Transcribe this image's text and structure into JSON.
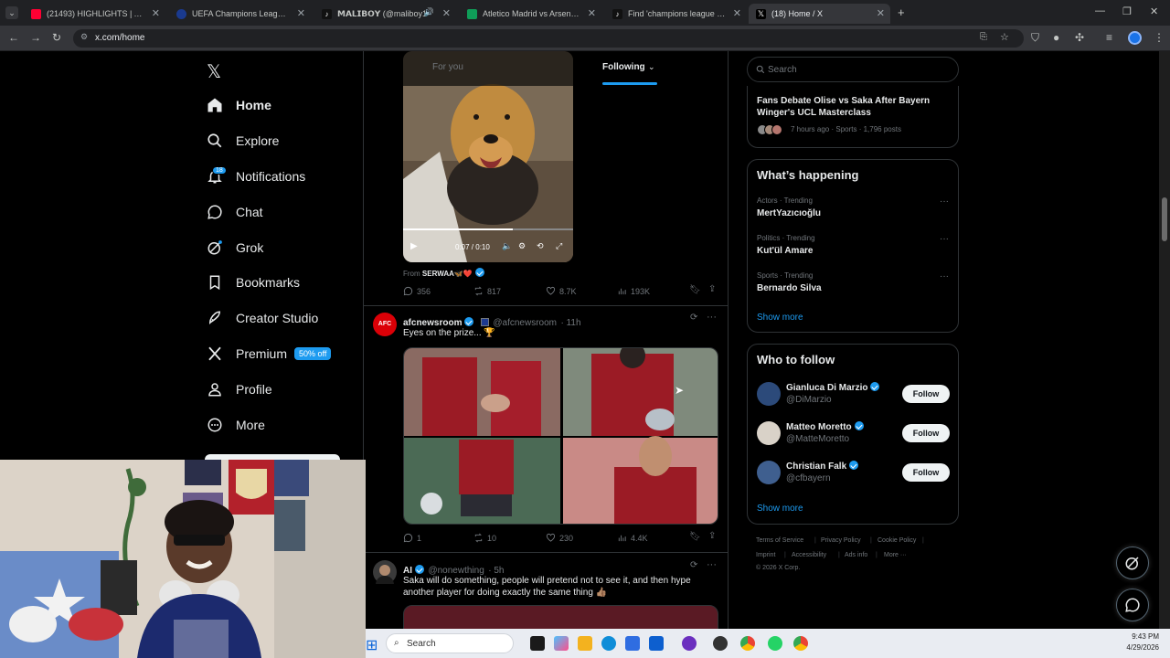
{
  "browser": {
    "tabs": [
      {
        "title": "(21493) HIGHLIGHTS | Arsenal v",
        "favicon_color": "#ff0033"
      },
      {
        "title": "UEFA Champions League | UEFA",
        "favicon_color": "#1a3a8f"
      },
      {
        "title": "𝗠𝗔𝗟𝗜𝗕𝗢𝗬 (@maliboy1",
        "favicon_color": "#111111"
      },
      {
        "title": "Atletico Madrid vs Arsenal - live",
        "favicon_color": "#0f9d58"
      },
      {
        "title": "Find 'champions league song' o",
        "favicon_color": "#111111"
      },
      {
        "title": "(18) Home / X",
        "favicon_color": "#000000"
      }
    ],
    "url": "x.com/home"
  },
  "nav": {
    "home": "Home",
    "explore": "Explore",
    "notifications": "Notifications",
    "notifications_badge": "18",
    "chat": "Chat",
    "grok": "Grok",
    "bookmarks": "Bookmarks",
    "creator_studio": "Creator Studio",
    "premium": "Premium",
    "premium_tag": "50% off",
    "profile": "Profile",
    "more": "More"
  },
  "feed": {
    "tab_for_you": "For you",
    "tab_following": "Following",
    "tweet1": {
      "video_time": "0:07 / 0:10",
      "from_label": "From",
      "from_name": "SERWAA🦋❤️",
      "replies": "356",
      "reposts": "817",
      "likes": "8.7K",
      "views": "193K"
    },
    "tweet2": {
      "avatar_text": "AFC",
      "name": "afcnewsroom",
      "handle": "@afcnewsroom",
      "time": "· 11h",
      "text": "Eyes on the prize... 🏆",
      "replies": "1",
      "reposts": "10",
      "likes": "230",
      "views": "4.4K"
    },
    "tweet3": {
      "name": "AI",
      "handle": "@nonewthing",
      "time": "· 5h",
      "text": "Saka will do something, people will pretend not to see it, and then hype another player for doing exactly the same thing 👍🏽"
    }
  },
  "right": {
    "search_placeholder": "Search",
    "top_story": {
      "title": "Fans Debate Olise vs Saka After Bayern Winger's UCL Masterclass",
      "meta": "7 hours ago · Sports · 1,796 posts"
    },
    "whats_happening": {
      "heading": "What’s happening",
      "trends": [
        {
          "category": "Actors · Trending",
          "name": "MertYazıcıoğlu"
        },
        {
          "category": "Politics · Trending",
          "name": "Kut'ül Amare"
        },
        {
          "category": "Sports · Trending",
          "name": "Bernardo Silva"
        }
      ],
      "show_more": "Show more"
    },
    "who_to_follow": {
      "heading": "Who to follow",
      "accounts": [
        {
          "name": "Gianluca Di Marzio",
          "handle": "@DiMarzio",
          "button": "Follow"
        },
        {
          "name": "Matteo Moretto",
          "handle": "@MatteMoretto",
          "button": "Follow"
        },
        {
          "name": "Christian Falk",
          "handle": "@cfbayern",
          "button": "Follow"
        }
      ],
      "show_more": "Show more"
    },
    "footer": {
      "terms": "Terms of Service",
      "privacy": "Privacy Policy",
      "cookie": "Cookie Policy",
      "imprint": "Imprint",
      "accessibility": "Accessibility",
      "ads": "Ads info",
      "more": "More ···",
      "copyright": "© 2026 X Corp."
    }
  },
  "taskbar": {
    "search_placeholder": "Search",
    "time": "9:43 PM",
    "date": "4/29/2026"
  }
}
